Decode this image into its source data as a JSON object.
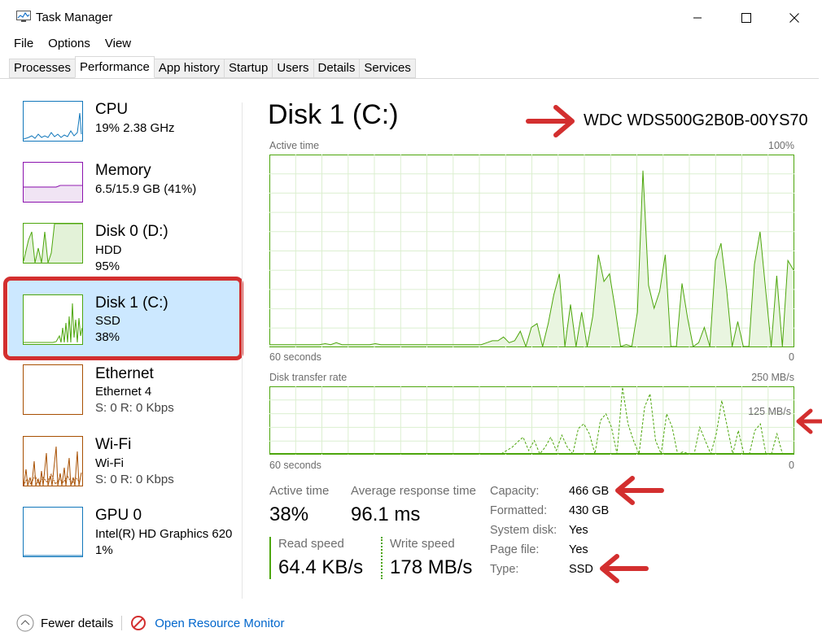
{
  "window": {
    "title": "Task Manager"
  },
  "menu": [
    "File",
    "Options",
    "View"
  ],
  "tabs": [
    "Processes",
    "Performance",
    "App history",
    "Startup",
    "Users",
    "Details",
    "Services"
  ],
  "sidebar": {
    "items": [
      {
        "name": "CPU",
        "line1": "19%  2.38 GHz",
        "line2": ""
      },
      {
        "name": "Memory",
        "line1": "6.5/15.9 GB (41%)",
        "line2": ""
      },
      {
        "name": "Disk 0 (D:)",
        "line1": "HDD",
        "line2": "95%"
      },
      {
        "name": "Disk 1 (C:)",
        "line1": "SSD",
        "line2": "38%"
      },
      {
        "name": "Ethernet",
        "line1": "Ethernet 4",
        "line2": "S: 0  R: 0 Kbps"
      },
      {
        "name": "Wi-Fi",
        "line1": "Wi-Fi",
        "line2": "S: 0  R: 0 Kbps"
      },
      {
        "name": "GPU 0",
        "line1": "Intel(R) HD Graphics 620",
        "line2": "1%"
      }
    ]
  },
  "main": {
    "title": "Disk 1 (C:)",
    "model": "WDC WDS500G2B0B-00YS70",
    "active_graph": {
      "label": "Active time",
      "max": "100%",
      "time_label": "60 seconds",
      "zero": "0",
      "values": [
        1,
        1,
        1,
        1,
        1,
        1,
        1,
        1,
        1,
        1,
        1.5,
        1,
        2,
        1,
        1,
        1,
        1,
        1,
        1,
        1.5,
        1,
        1,
        1,
        1,
        1,
        1,
        1,
        1,
        1,
        1,
        1,
        1,
        1,
        1,
        1,
        1,
        1,
        1,
        1,
        2,
        3,
        3,
        5,
        2,
        3,
        8,
        0,
        10,
        12,
        0,
        12,
        27,
        38,
        0,
        22,
        0,
        18,
        0,
        16,
        48,
        34,
        38,
        20,
        0,
        1,
        0,
        18,
        92,
        32,
        20,
        29,
        48,
        0,
        0,
        33,
        15,
        0,
        2,
        10,
        0,
        45,
        54,
        30,
        0,
        13,
        0,
        0,
        43,
        60,
        30,
        0,
        37,
        0,
        45,
        40
      ]
    },
    "transfer_graph": {
      "label": "Disk transfer rate",
      "max": "250 MB/s",
      "mid": "125 MB/s",
      "time_label": "60 seconds",
      "zero": "0",
      "values": [
        0,
        0,
        0,
        0,
        0,
        0,
        0,
        0,
        0,
        0,
        0,
        0,
        0,
        0,
        0,
        0,
        0,
        0,
        0,
        0,
        0,
        0,
        0,
        0,
        0,
        0,
        0,
        0,
        0,
        0,
        0,
        0,
        0,
        0,
        0,
        0,
        0,
        0,
        0,
        0,
        0,
        0,
        0,
        5,
        10,
        18,
        25,
        5,
        20,
        0,
        10,
        25,
        5,
        28,
        10,
        0,
        38,
        45,
        30,
        0,
        50,
        60,
        40,
        0,
        100,
        45,
        20,
        0,
        70,
        90,
        20,
        0,
        60,
        40,
        0,
        3,
        0,
        0,
        40,
        20,
        0,
        30,
        80,
        40,
        0,
        35,
        0,
        0,
        35,
        45,
        0,
        0,
        30,
        0,
        0,
        0
      ]
    },
    "stats": {
      "active_time_label": "Active time",
      "active_time": "38%",
      "avg_response_label": "Average response time",
      "avg_response": "96.1 ms",
      "read_label": "Read speed",
      "read": "64.4 KB/s",
      "write_label": "Write speed",
      "write": "178 MB/s"
    },
    "info": [
      {
        "key": "Capacity:",
        "value": "466 GB"
      },
      {
        "key": "Formatted:",
        "value": "430 GB"
      },
      {
        "key": "System disk:",
        "value": "Yes"
      },
      {
        "key": "Page file:",
        "value": "Yes"
      },
      {
        "key": "Type:",
        "value": "SSD"
      }
    ]
  },
  "footer": {
    "fewer_details": "Fewer details",
    "resource_monitor": "Open Resource Monitor"
  },
  "colors": {
    "disk_green": "#4da60c",
    "cpu_blue": "#1177bb",
    "memory_purple": "#8b12ae",
    "net_orange": "#a74f01",
    "selected_bg": "#cce8ff",
    "annotation_red": "#d32f2f"
  }
}
